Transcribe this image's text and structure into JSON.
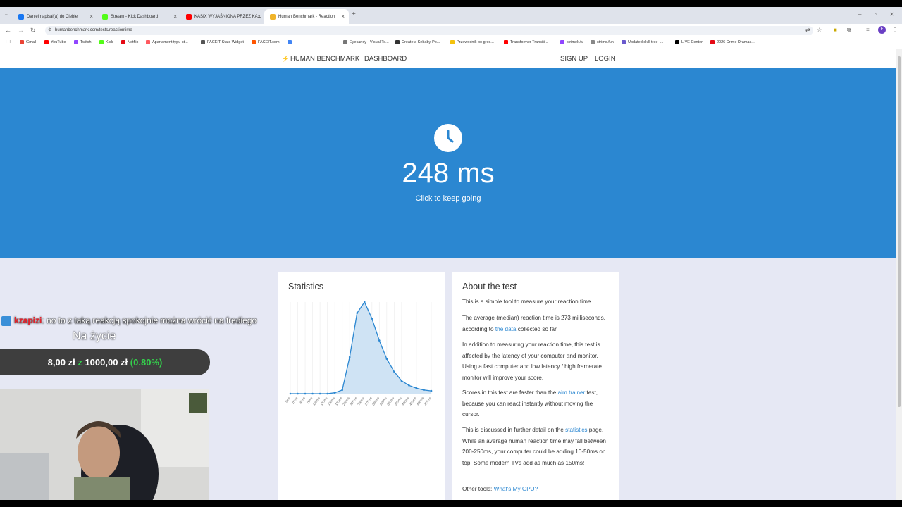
{
  "tabs": [
    {
      "title": "Daniel napisał(a) do Ciebie",
      "color": "#1877f2"
    },
    {
      "title": "Stream - Kick Dashboard",
      "color": "#53fc18"
    },
    {
      "title": "KASIX WYJAŚNIONA PRZEZ KA...",
      "color": "#ff0000"
    },
    {
      "title": "Human Benchmark - Reaction",
      "color": "#f0b429"
    }
  ],
  "address": {
    "url": "humanbenchmark.com/tests/reactiontime"
  },
  "bookmarks": [
    {
      "label": "Gmail",
      "color": "#ea4335"
    },
    {
      "label": "YouTube",
      "color": "#ff0000"
    },
    {
      "label": "Twitch",
      "color": "#9146ff"
    },
    {
      "label": "Kick",
      "color": "#53fc18"
    },
    {
      "label": "Netflix",
      "color": "#e50914"
    },
    {
      "label": "Apartament typu st...",
      "color": "#ff5a5f"
    },
    {
      "label": "FACEIT Stats Widget",
      "color": "#555555"
    },
    {
      "label": "FACEIT.com",
      "color": "#ff5500"
    },
    {
      "label": "-----------------------",
      "color": "#4285f4"
    },
    {
      "label": "Eyecandy - Visual Te...",
      "color": "#777777"
    },
    {
      "label": "Create a Kebaby-Po...",
      "color": "#333333"
    },
    {
      "label": "Przewodnik po gres...",
      "color": "#f4c20d"
    },
    {
      "label": "Transformer Transiti...",
      "color": "#ff0000"
    },
    {
      "label": "strimek.tv",
      "color": "#9146ff"
    },
    {
      "label": "strims.fun",
      "color": "#888888"
    },
    {
      "label": "Updated skill tree -...",
      "color": "#6a5acd"
    },
    {
      "label": "LIVE Center",
      "color": "#000000"
    },
    {
      "label": "2026 Crime Dramas...",
      "color": "#e50914"
    }
  ],
  "sitenav": {
    "brand": "HUMAN BENCHMARK",
    "dashboard": "DASHBOARD",
    "signup": "SIGN UP",
    "login": "LOGIN"
  },
  "hero": {
    "score": "248 ms",
    "hint": "Click to keep going"
  },
  "statistics": {
    "title": "Statistics"
  },
  "chart_data": {
    "type": "area",
    "x_labels": [
      "0ms",
      "25ms",
      "50ms",
      "75ms",
      "100ms",
      "125ms",
      "150ms",
      "175ms",
      "200ms",
      "225ms",
      "250ms",
      "275ms",
      "300ms",
      "325ms",
      "350ms",
      "375ms",
      "400ms",
      "425ms",
      "450ms",
      "475ms"
    ],
    "x": [
      0,
      25,
      50,
      75,
      100,
      125,
      150,
      175,
      200,
      225,
      250,
      275,
      300,
      325,
      350,
      375,
      400,
      425,
      450,
      475
    ],
    "values": [
      0,
      0,
      0,
      0,
      0,
      0,
      1,
      4,
      40,
      88,
      100,
      82,
      58,
      38,
      24,
      14,
      9,
      6,
      4,
      3
    ],
    "color": "#2b87d1"
  },
  "about": {
    "title": "About the test",
    "p1": "This is a simple tool to measure your reaction time.",
    "p2a": "The average (median) reaction time is 273 milliseconds, according to ",
    "p2link": "the data",
    "p2b": " collected so far.",
    "p3": "In addition to measuring your reaction time, this test is affected by the latency of your computer and monitor. Using a fast computer and low latency / high framerate monitor will improve your score.",
    "p4a": "Scores in this test are faster than the ",
    "p4link": "aim trainer",
    "p4b": " test, because you can react instantly without moving the cursor.",
    "p5a": "This is discussed in further detail on the ",
    "p5link": "statistics",
    "p5b": " page. While an average human reaction time may fall between 200-250ms, your computer could be adding 10-50ms on top. Some modern TVs add as much as 150ms!",
    "p6a": "Other tools: ",
    "p6link": "What's My GPU?"
  },
  "overlay": {
    "user": "kzapizi",
    "message": ": no to z taką reakcją spokojnie można wrócić na frediego",
    "caption": "Na życie",
    "donation_current": "8,00 zł",
    "donation_z": "z",
    "donation_goal": "1000,00 zł",
    "donation_pct": "(0.80%)"
  }
}
